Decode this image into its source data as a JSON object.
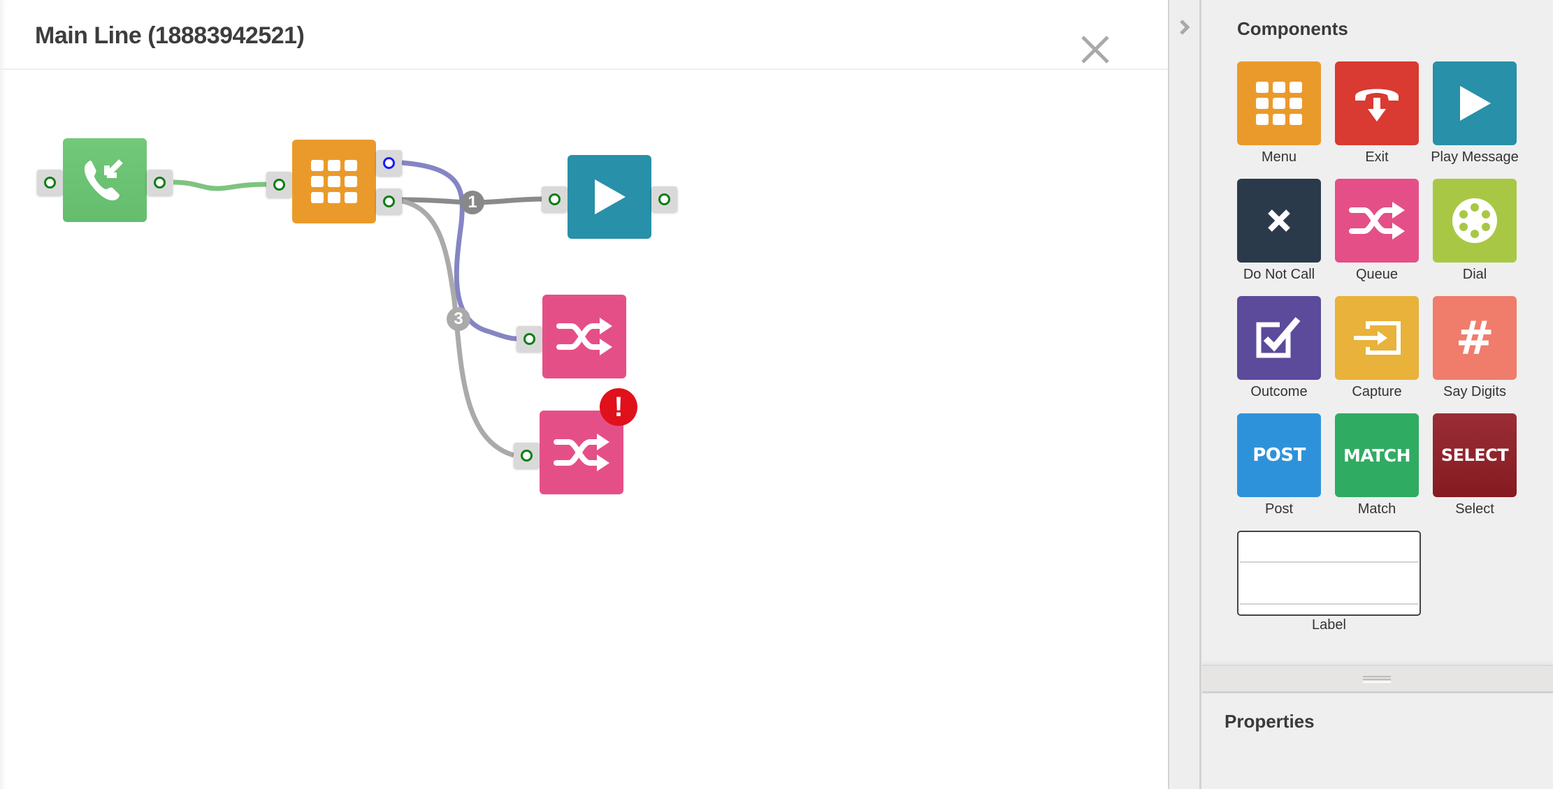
{
  "header": {
    "title": "Main Line (18883942521)",
    "close_icon": "close-icon"
  },
  "canvas": {
    "nodes": [
      {
        "id": "incoming-call",
        "type": "Incoming Call",
        "icon": "incoming-call-icon",
        "color": "#6cc374"
      },
      {
        "id": "menu",
        "type": "Menu",
        "icon": "keypad-grid-icon",
        "color": "#ea9a2b"
      },
      {
        "id": "play-message",
        "type": "Play Message",
        "icon": "play-icon",
        "color": "#2890a8"
      },
      {
        "id": "queue-1",
        "type": "Queue",
        "icon": "shuffle-icon",
        "color": "#e54f88"
      },
      {
        "id": "queue-2",
        "type": "Queue",
        "icon": "shuffle-icon",
        "color": "#e54f88",
        "error": true,
        "error_icon": "exclamation-icon",
        "error_text": "!"
      }
    ],
    "connections": [
      {
        "from": "incoming-call",
        "to": "menu",
        "color": "#7dc47f"
      },
      {
        "from": "menu",
        "to": "play-message",
        "label": "1",
        "color": "#8a8a8a"
      },
      {
        "from": "menu",
        "to": "queue-1",
        "color": "#8585c4"
      },
      {
        "from": "menu",
        "to": "queue-2",
        "label": "3",
        "color": "#aaaaaa"
      }
    ],
    "connection_labels": [
      "1",
      "3"
    ]
  },
  "sidebar": {
    "collapse_icon": "chevron-right-icon",
    "components_title": "Components",
    "components": [
      {
        "label": "Menu",
        "icon": "keypad-grid-icon",
        "color": "#ea9a2b"
      },
      {
        "label": "Exit",
        "icon": "hangup-icon",
        "color": "#d93a31"
      },
      {
        "label": "Play Message",
        "icon": "play-icon",
        "color": "#2890a8"
      },
      {
        "label": "Do Not Call",
        "icon": "x-icon",
        "color": "#2b3a4b"
      },
      {
        "label": "Queue",
        "icon": "shuffle-icon",
        "color": "#e54f88"
      },
      {
        "label": "Dial",
        "icon": "rotary-dial-icon",
        "color": "#a8c845"
      },
      {
        "label": "Outcome",
        "icon": "checkbox-icon",
        "color": "#5c4a9a"
      },
      {
        "label": "Capture",
        "icon": "input-icon",
        "color": "#e9b23a"
      },
      {
        "label": "Say Digits",
        "icon": "hash-icon",
        "color": "#f07c6b",
        "icon_text": "#"
      },
      {
        "label": "Post",
        "icon": "post-text-icon",
        "color": "#2e92db",
        "icon_text": "POST"
      },
      {
        "label": "Match",
        "icon": "match-text-icon",
        "color": "#30ab62",
        "icon_text": "MATCH"
      },
      {
        "label": "Select",
        "icon": "select-text-icon",
        "color": "#8c1f25",
        "icon_text": "SELECT"
      },
      {
        "label": "Label",
        "icon": "label-box-icon"
      }
    ],
    "properties_title": "Properties"
  }
}
